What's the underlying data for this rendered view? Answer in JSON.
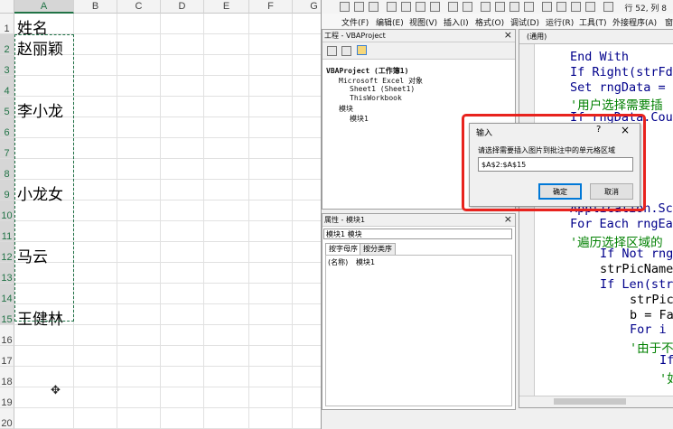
{
  "sheet": {
    "columns": [
      "A",
      "B",
      "C",
      "D",
      "E",
      "F",
      "G",
      "H"
    ],
    "rows": [
      "1",
      "2",
      "3",
      "4",
      "5",
      "6",
      "7",
      "8",
      "9",
      "10",
      "11",
      "12",
      "13",
      "14",
      "15",
      "16",
      "17",
      "18",
      "19",
      "20"
    ],
    "cells": [
      {
        "row": "1",
        "value": "姓名"
      },
      {
        "row": "2",
        "value": "赵丽颖"
      },
      {
        "row": "5",
        "value": "李小龙"
      },
      {
        "row": "9",
        "value": "小龙女"
      },
      {
        "row": "12",
        "value": "马云"
      },
      {
        "row": "15",
        "value": "王健林"
      }
    ],
    "cursor_glyph": "✥"
  },
  "vbe": {
    "menu": [
      "文件(F)",
      "编辑(E)",
      "视图(V)",
      "插入(I)",
      "格式(O)",
      "调试(D)",
      "运行(R)",
      "工具(T)",
      "外接程序(A)",
      "窗口"
    ],
    "position": "行 52, 列 8",
    "project": {
      "title": "工程 - VBAProject",
      "close": "×",
      "tree": [
        "VBAProject (工作簿1)",
        "Microsoft Excel 对象",
        "Sheet1 (Sheet1)",
        "ThisWorkbook",
        "模块",
        "模块1"
      ]
    },
    "properties": {
      "title": "属性 - 模块1",
      "close": "×",
      "object": "模块1 模块",
      "tabs": [
        "按字母序",
        "按分类序"
      ],
      "row_name": "(名称)",
      "row_value": "模块1"
    },
    "code": {
      "proc": "(通用)",
      "lines": [
        {
          "text": "End With",
          "cls": "kw",
          "ind": "0"
        },
        {
          "text": "If Right(strFd",
          "cls": "kw",
          "ind": "0"
        },
        {
          "text": "Set rngData = ",
          "cls": "kw",
          "ind": "0"
        },
        {
          "text": "'用户选择需要插",
          "cls": "cm",
          "ind": "0"
        },
        {
          "text": "If rngData.Cou",
          "cls": "kw",
          "ind": "0"
        },
        {
          "text": "  a = ",
          "cls": "tx",
          "ind": "0"
        },
        {
          "text": "  语句",
          "cls": "cm",
          "ind": "0"
        },
        {
          "text": "  Is ",
          "cls": "kw",
          "ind": "0"
        },
        {
          "text": "  y(\".",
          "cls": "tx",
          "ind": "0"
        },
        {
          "text": "  登记录",
          "cls": "cm",
          "ind": "0"
        },
        {
          "text": "Application.Sc",
          "cls": "kw",
          "ind": "0"
        },
        {
          "text": "For Each rngEa",
          "cls": "kw",
          "ind": "0"
        },
        {
          "text": "'遍历选择区域的",
          "cls": "cm",
          "ind": "0"
        },
        {
          "text": "If Not rng",
          "cls": "kw",
          "ind": "1"
        },
        {
          "text": "strPicName",
          "cls": "tx",
          "ind": "1"
        },
        {
          "text": "If Len(str",
          "cls": "kw",
          "ind": "1"
        },
        {
          "text": "strPic",
          "cls": "tx",
          "ind": "2"
        },
        {
          "text": "b = Fa",
          "cls": "tx",
          "ind": "2"
        },
        {
          "text": "For i ",
          "cls": "kw",
          "ind": "2"
        },
        {
          "text": "'由于不",
          "cls": "cm",
          "ind": "2"
        },
        {
          "text": "If",
          "cls": "kw",
          "ind": "3"
        },
        {
          "text": "'如",
          "cls": "cm",
          "ind": "3"
        }
      ]
    }
  },
  "dialog": {
    "title": "输入",
    "help": "?",
    "close": "×",
    "prompt": "请选择需要插入图片到批注中的单元格区域",
    "value": "$A$2:$A$15",
    "ok": "确定",
    "cancel": "取消"
  },
  "colors": {
    "excel_green": "#217346",
    "highlight": "#e8231e",
    "vba_keyword": "#00008b",
    "vba_comment": "#008000"
  }
}
